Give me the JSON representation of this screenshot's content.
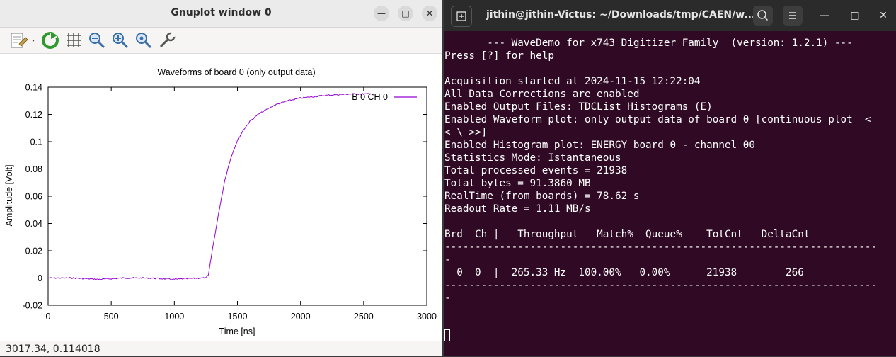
{
  "gnuplot": {
    "window_title": "Gnuplot window 0",
    "status": "3017.34,  0.114018",
    "toolbar_items": [
      "copy-icon",
      "replot-icon",
      "grid-icon",
      "zoom-previous-icon",
      "zoom-next-icon",
      "autoscale-icon",
      "settings-icon"
    ]
  },
  "chart_data": {
    "type": "line",
    "title": "Waveforms of board 0 (only output data)",
    "xlabel": "Time [ns]",
    "ylabel": "Amplitude [Volt]",
    "xlim": [
      0,
      3000
    ],
    "ylim": [
      -0.02,
      0.14
    ],
    "x_ticks": [
      "0",
      "500",
      "1000",
      "1500",
      "2000",
      "2500",
      "3000"
    ],
    "y_ticks": [
      "-0.02",
      "0",
      "0.02",
      "0.04",
      "0.06",
      "0.08",
      "0.1",
      "0.12",
      "0.14"
    ],
    "series": [
      {
        "name": "B 0 CH 0",
        "color": "#9400d3",
        "x": [
          0,
          200,
          400,
          600,
          800,
          1000,
          1200,
          1250,
          1270,
          1300,
          1350,
          1400,
          1450,
          1500,
          1550,
          1600,
          1650,
          1700,
          1800,
          1900,
          2000,
          2100,
          2200,
          2300,
          2400,
          2500,
          2560
        ],
        "y": [
          0.0,
          0.0,
          -0.001,
          0.0,
          0.0,
          -0.001,
          0.0,
          0.0,
          0.002,
          0.02,
          0.047,
          0.072,
          0.089,
          0.101,
          0.109,
          0.115,
          0.119,
          0.122,
          0.127,
          0.13,
          0.132,
          0.133,
          0.134,
          0.1345,
          0.135,
          0.135,
          0.135
        ]
      }
    ]
  },
  "terminal": {
    "title": "jithin@jithin-Victus: ~/Downloads/tmp/CAEN/w...",
    "lines": [
      "       --- WaveDemo for x743 Digitizer Family  (version: 1.2.1) ---",
      "Press [?] for help",
      "",
      "Acquisition started at 2024-11-15 12:22:04",
      "All Data Corrections are enabled",
      "Enabled Output Files: TDCList Histograms (E)",
      "Enabled Waveform plot: only output data of board 0 [continuous plot  <",
      "< \\ >>]",
      "Enabled Histogram plot: ENERGY board 0 - channel 00",
      "Statistics Mode: Istantaneous",
      "Total processed events = 21938",
      "Total bytes = 91.3860 MB",
      "RealTime (from boards) = 78.62 s",
      "Readout Rate = 1.11 MB/s",
      "",
      "Brd  Ch |   Throughput   Match%  Queue%    TotCnt   DeltaCnt",
      "-----------------------------------------------------------------------",
      "-",
      "  0  0  |  265.33 Hz  100.00%   0.00%      21938        266",
      "-----------------------------------------------------------------------",
      "-"
    ]
  }
}
